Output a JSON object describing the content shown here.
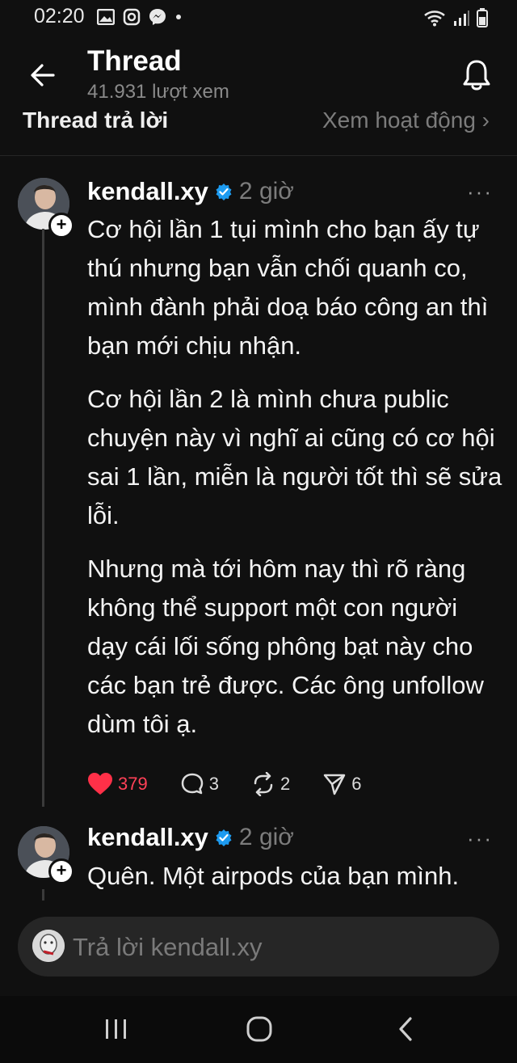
{
  "status_bar": {
    "time": "02:20",
    "icons": [
      "image-icon",
      "instagram-icon",
      "messenger-icon",
      "dot-icon",
      "wifi-icon",
      "signal-icon",
      "battery-icon"
    ]
  },
  "header": {
    "title": "Thread",
    "views": "41.931 lượt xem"
  },
  "section": {
    "left_label": "Thread trả lời",
    "right_label": "Xem hoạt động ›"
  },
  "posts": [
    {
      "username": "kendall.xy",
      "time": "2 giờ",
      "more": "···",
      "paragraphs": [
        "Cơ hội lần 1 tụi mình cho bạn ấy tự thú nhưng bạn vẫn chối quanh co, mình đành phải doạ báo công an thì bạn mới chịu nhận.",
        "Cơ hội lần 2 là mình chưa public chuyện này vì nghĩ ai cũng có cơ hội sai 1 lần, miễn là người tốt thì sẽ sửa lỗi.",
        "Nhưng mà tới hôm nay thì rõ ràng không thể support một con người dạy cái lối sống phông bạt này cho các bạn trẻ được. Các ông unfollow dùm tôi ạ."
      ],
      "likes": "379",
      "comments": "3",
      "reposts": "2",
      "shares": "6"
    },
    {
      "username": "kendall.xy",
      "time": "2 giờ",
      "more": "···",
      "paragraphs": [
        "Quên. Một airpods của bạn mình."
      ]
    }
  ],
  "reply": {
    "placeholder": "Trả lời kendall.xy"
  },
  "colors": {
    "background": "#101010",
    "like": "#ff4157",
    "verified": "#1d9bf0",
    "muted": "#7c7c7c"
  }
}
